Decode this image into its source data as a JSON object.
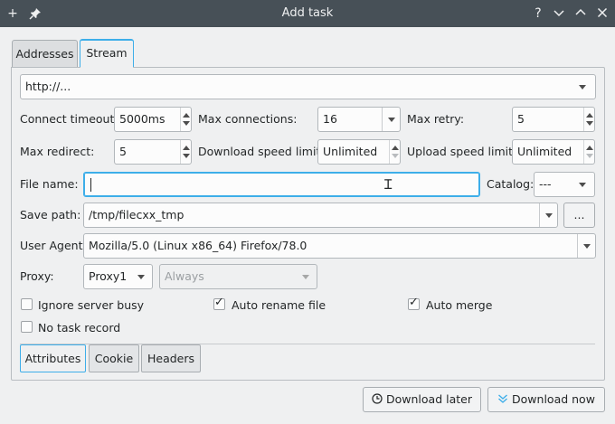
{
  "window": {
    "title": "Add task",
    "buttons": {
      "add": "+",
      "help": "?"
    }
  },
  "tabs": [
    "Addresses",
    "Stream"
  ],
  "url": {
    "value": "http://..."
  },
  "connect_timeout": {
    "label": "Connect timeout:",
    "value": "5000ms"
  },
  "max_connections": {
    "label": "Max connections:",
    "value": "16"
  },
  "max_retry": {
    "label": "Max retry:",
    "value": "5"
  },
  "max_redirect": {
    "label": "Max redirect:",
    "value": "5"
  },
  "download_speed": {
    "label": "Download speed limit:",
    "value": "Unlimited"
  },
  "upload_speed": {
    "label": "Upload speed limit:",
    "value": "Unlimited"
  },
  "file_name": {
    "label": "File name:",
    "value": ""
  },
  "catalog": {
    "label": "Catalog:",
    "value": "---"
  },
  "save_path": {
    "label": "Save path:",
    "value": "/tmp/filecxx_tmp",
    "browse_label": "..."
  },
  "user_agent": {
    "label": "User Agent:",
    "value": "Mozilla/5.0 (Linux x86_64) Firefox/78.0"
  },
  "proxy": {
    "label": "Proxy:",
    "value": "Proxy1",
    "mode": "Always"
  },
  "checkboxes": {
    "ignore_busy": {
      "label": "Ignore server busy",
      "checked": false
    },
    "auto_rename": {
      "label": "Auto rename file",
      "checked": true
    },
    "auto_merge": {
      "label": "Auto merge",
      "checked": true
    },
    "no_record": {
      "label": "No task record",
      "checked": false
    }
  },
  "subtabs": [
    "Attributes",
    "Cookie",
    "Headers"
  ],
  "footer": {
    "later_label": "Download later",
    "now_label": "Download now"
  },
  "colors": {
    "accent": "#3daee9",
    "titlebar": "#475057",
    "window_bg": "#eff0f1"
  }
}
